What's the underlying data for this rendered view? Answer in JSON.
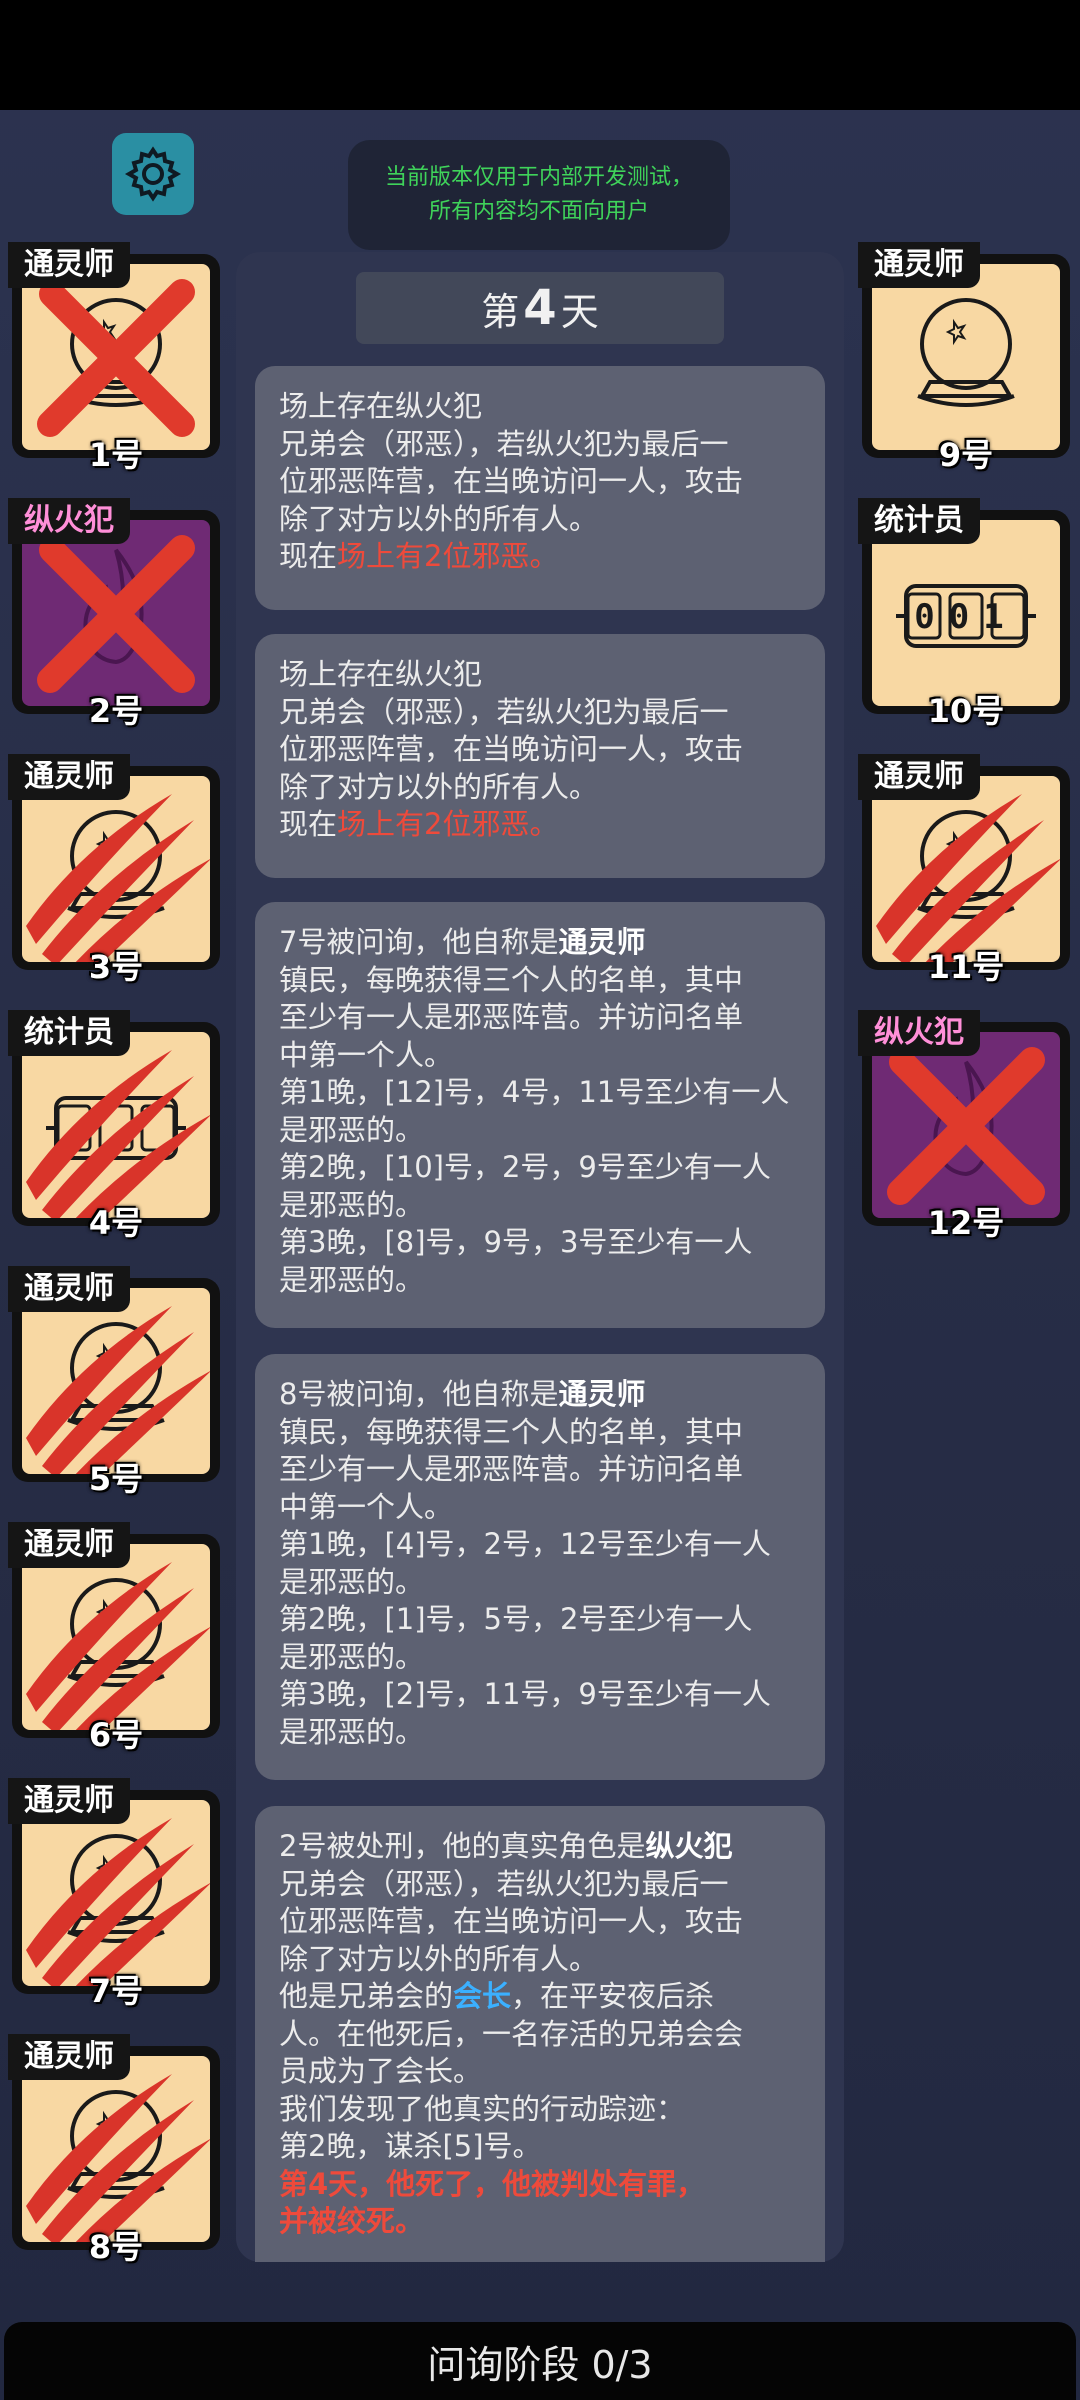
{
  "notice": {
    "line1": "当前版本仅用于内部开发测试，",
    "line2": "所有内容均不面向用户"
  },
  "day": {
    "prefix": "第",
    "number": "4",
    "suffix": "天"
  },
  "players": [
    {
      "role": "通灵师",
      "num": "1号",
      "icon": "crystal-ball",
      "status": "crossed-out",
      "face": "tan"
    },
    {
      "role": "纵火犯",
      "num": "2号",
      "icon": "fire",
      "status": "crossed-out",
      "face": "purple"
    },
    {
      "role": "通灵师",
      "num": "3号",
      "icon": "crystal-ball",
      "status": "clawed",
      "face": "tan"
    },
    {
      "role": "统计员",
      "num": "4号",
      "icon": "counter",
      "status": "clawed",
      "face": "tan"
    },
    {
      "role": "通灵师",
      "num": "5号",
      "icon": "crystal-ball",
      "status": "clawed",
      "face": "tan"
    },
    {
      "role": "通灵师",
      "num": "6号",
      "icon": "crystal-ball",
      "status": "clawed",
      "face": "tan"
    },
    {
      "role": "通灵师",
      "num": "7号",
      "icon": "crystal-ball",
      "status": "clawed",
      "face": "tan"
    },
    {
      "role": "通灵师",
      "num": "8号",
      "icon": "crystal-ball",
      "status": "clawed",
      "face": "tan"
    },
    {
      "role": "通灵师",
      "num": "9号",
      "icon": "crystal-ball",
      "status": "alive",
      "face": "tan"
    },
    {
      "role": "统计员",
      "num": "10号",
      "icon": "counter",
      "status": "alive",
      "face": "tan",
      "counter_text": "001"
    },
    {
      "role": "通灵师",
      "num": "11号",
      "icon": "crystal-ball",
      "status": "clawed",
      "face": "tan"
    },
    {
      "role": "纵火犯",
      "num": "12号",
      "icon": "fire",
      "status": "crossed-out",
      "face": "purple"
    }
  ],
  "messages": [
    {
      "lines": [
        "场上存在纵火犯",
        "兄弟会（邪恶），若纵火犯为最后一",
        "位邪恶阵营，在当晚访问一人，攻击",
        "除了对方以外的所有人。"
      ],
      "last_prefix": "现在",
      "last_highlight": "场上有2位邪恶。"
    },
    {
      "lines": [
        "场上存在纵火犯",
        "兄弟会（邪恶），若纵火犯为最后一",
        "位邪恶阵营，在当晚访问一人，攻击",
        "除了对方以外的所有人。"
      ],
      "last_prefix": "现在",
      "last_highlight": "场上有2位邪恶。"
    },
    {
      "head": "7号被问询，他自称是",
      "head_bold": "通灵师",
      "lines": [
        "镇民，每晚获得三个人的名单，其中",
        "至少有一人是邪恶阵营。并访问名单",
        "中第一个人。",
        "第1晚，[12]号，4号，11号至少有一人",
        "是邪恶的。",
        "第2晚，[10]号，2号，9号至少有一人",
        "是邪恶的。",
        "第3晚，[8]号，9号，3号至少有一人",
        "是邪恶的。"
      ]
    },
    {
      "head": "8号被问询，他自称是",
      "head_bold": "通灵师",
      "lines": [
        "镇民，每晚获得三个人的名单，其中",
        "至少有一人是邪恶阵营。并访问名单",
        "中第一个人。",
        "第1晚，[4]号，2号，12号至少有一人",
        "是邪恶的。",
        "第2晚，[1]号，5号，2号至少有一人",
        "是邪恶的。",
        "第3晚，[2]号，11号，9号至少有一人",
        "是邪恶的。"
      ]
    },
    {
      "head": "2号被处刑，他的真实角色是",
      "head_bold": "纵火犯",
      "lines": [
        "兄弟会（邪恶），若纵火犯为最后一",
        "位邪恶阵营，在当晚访问一人，攻击",
        "除了对方以外的所有人。"
      ],
      "leader_prefix": "他是兄弟会的",
      "leader_word": "会长",
      "leader_suffix": "，在平安夜后杀",
      "lines2": [
        "人。在他死后，一名存活的兄弟会会",
        "员成为了会长。",
        "我们发现了他真实的行动踪迹：",
        "第2晚，谋杀[5]号。"
      ],
      "verdict1": "第4天，他死了，他被判处有罪，",
      "verdict2": "并被绞死。"
    }
  ],
  "phase": "问询阶段 0/3",
  "colors": {
    "evil_red": "#ee4a3b",
    "leader_blue": "#3bb0ff",
    "notice_green": "#3fd35a"
  }
}
